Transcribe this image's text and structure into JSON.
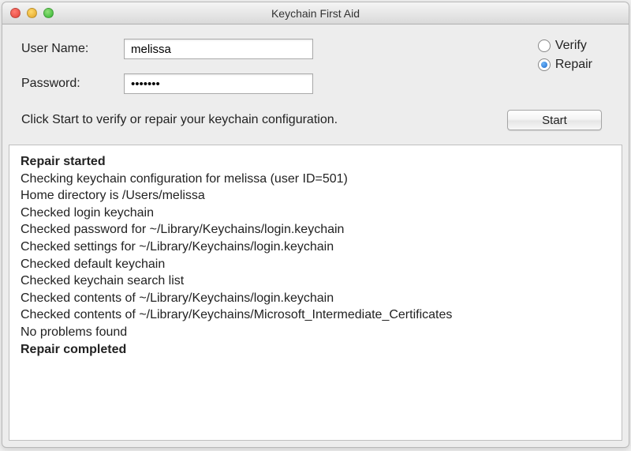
{
  "window": {
    "title": "Keychain First Aid"
  },
  "form": {
    "username_label": "User Name:",
    "username_value": "melissa",
    "password_label": "Password:",
    "password_value": "•••••••",
    "hint": "Click Start to verify or repair your keychain configuration.",
    "start_label": "Start"
  },
  "radio": {
    "verify_label": "Verify",
    "repair_label": "Repair",
    "selected": "repair"
  },
  "log": [
    {
      "text": "Repair started",
      "bold": true
    },
    {
      "text": "Checking keychain configuration for melissa (user ID=501)",
      "bold": false
    },
    {
      "text": "Home directory is /Users/melissa",
      "bold": false
    },
    {
      "text": "Checked login keychain",
      "bold": false
    },
    {
      "text": "Checked password for ~/Library/Keychains/login.keychain",
      "bold": false
    },
    {
      "text": "Checked settings for ~/Library/Keychains/login.keychain",
      "bold": false
    },
    {
      "text": "Checked default keychain",
      "bold": false
    },
    {
      "text": "Checked keychain search list",
      "bold": false
    },
    {
      "text": "Checked contents of ~/Library/Keychains/login.keychain",
      "bold": false
    },
    {
      "text": "Checked contents of ~/Library/Keychains/Microsoft_Intermediate_Certificates",
      "bold": false
    },
    {
      "text": "No problems found",
      "bold": false
    },
    {
      "text": "Repair completed",
      "bold": true
    }
  ]
}
